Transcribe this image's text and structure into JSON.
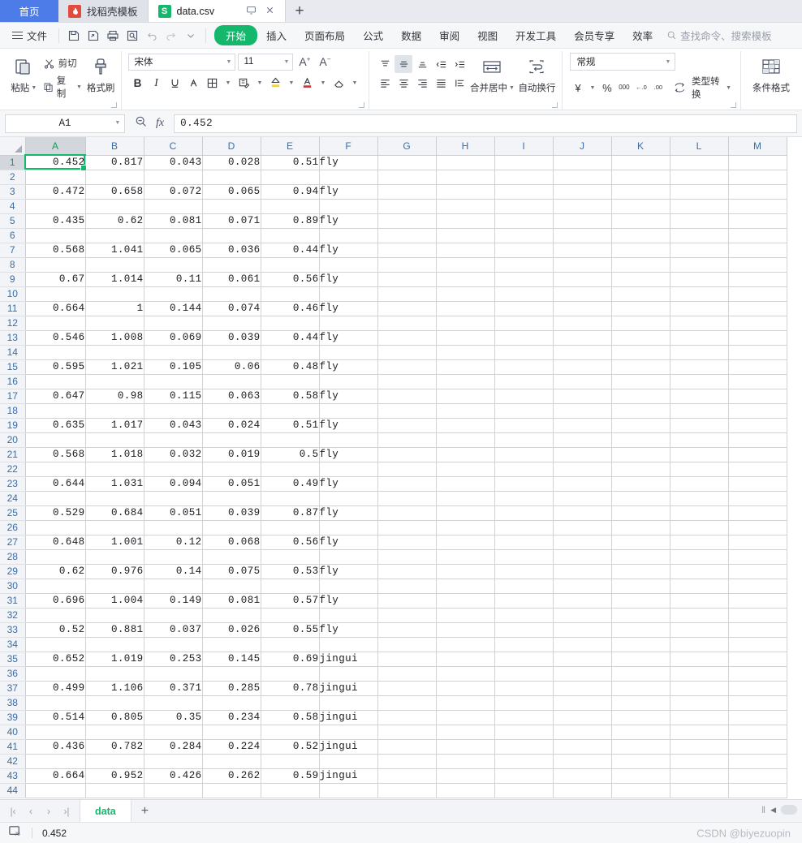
{
  "window": {
    "tabs": [
      {
        "label": "首页",
        "icon": "home-tab",
        "active": false,
        "kind": "home"
      },
      {
        "label": "找稻壳模板",
        "icon": "docer-icon",
        "active": false,
        "kind": "docer"
      },
      {
        "label": "data.csv",
        "icon": "sheet-icon",
        "active": true,
        "kind": "sheet"
      }
    ],
    "tab_actions": {
      "restore": "monitor-icon",
      "close": "close-icon"
    },
    "new_tab_label": "+"
  },
  "menubar": {
    "file_label": "文件",
    "quick_access": [
      "save-icon",
      "save-as-icon",
      "print-icon",
      "print-preview-icon",
      "undo-icon",
      "redo-icon",
      "customize-caret-icon"
    ],
    "start_tab": "开始",
    "items": [
      "插入",
      "页面布局",
      "公式",
      "数据",
      "审阅",
      "视图",
      "开发工具",
      "会员专享",
      "效率"
    ],
    "search_placeholder": "查找命令、搜索模板"
  },
  "ribbon": {
    "clipboard": {
      "paste": "粘贴",
      "cut": "剪切",
      "copy": "复制",
      "format_painter": "格式刷"
    },
    "font": {
      "name": "宋体",
      "size": "11",
      "grow": "A+",
      "shrink": "A-",
      "bold": "B",
      "italic": "I",
      "underline": "U",
      "strikethrough": "A",
      "borders": "borders-icon",
      "more_format": "more-format-icon",
      "fill_color": "fill-color-icon",
      "font_color": "font-color-icon",
      "clear_format": "clear-format-icon"
    },
    "alignment": {
      "merge_center": "合并居中",
      "wrap_text": "自动换行"
    },
    "number": {
      "format": "常规",
      "currency": "¥",
      "percent": "%",
      "comma": "000",
      "increase_decimal": "←.0",
      "decrease_decimal": ".00",
      "type_convert": "类型转换"
    },
    "styles": {
      "conditional_format": "条件格式"
    }
  },
  "formula_bar": {
    "name_box": "A1",
    "zoom_icon": "zoom-out-icon",
    "fx_icon": "fx",
    "formula_value": "0.452"
  },
  "grid": {
    "columns": [
      "A",
      "B",
      "C",
      "D",
      "E",
      "F",
      "G",
      "H",
      "I",
      "J",
      "K",
      "L",
      "M"
    ],
    "selected_column": "A",
    "selected_row": 1,
    "selected_cell": "A1",
    "row_count": 44,
    "rows": [
      {
        "n": 1,
        "cells": [
          "0.452",
          "0.817",
          "0.043",
          "0.028",
          "0.51",
          "fly"
        ]
      },
      {
        "n": 2,
        "cells": [
          "",
          "",
          "",
          "",
          "",
          ""
        ]
      },
      {
        "n": 3,
        "cells": [
          "0.472",
          "0.658",
          "0.072",
          "0.065",
          "0.94",
          "fly"
        ]
      },
      {
        "n": 4,
        "cells": [
          "",
          "",
          "",
          "",
          "",
          ""
        ]
      },
      {
        "n": 5,
        "cells": [
          "0.435",
          "0.62",
          "0.081",
          "0.071",
          "0.89",
          "fly"
        ]
      },
      {
        "n": 6,
        "cells": [
          "",
          "",
          "",
          "",
          "",
          ""
        ]
      },
      {
        "n": 7,
        "cells": [
          "0.568",
          "1.041",
          "0.065",
          "0.036",
          "0.44",
          "fly"
        ]
      },
      {
        "n": 8,
        "cells": [
          "",
          "",
          "",
          "",
          "",
          ""
        ]
      },
      {
        "n": 9,
        "cells": [
          "0.67",
          "1.014",
          "0.11",
          "0.061",
          "0.56",
          "fly"
        ]
      },
      {
        "n": 10,
        "cells": [
          "",
          "",
          "",
          "",
          "",
          ""
        ]
      },
      {
        "n": 11,
        "cells": [
          "0.664",
          "1",
          "0.144",
          "0.074",
          "0.46",
          "fly"
        ]
      },
      {
        "n": 12,
        "cells": [
          "",
          "",
          "",
          "",
          "",
          ""
        ]
      },
      {
        "n": 13,
        "cells": [
          "0.546",
          "1.008",
          "0.069",
          "0.039",
          "0.44",
          "fly"
        ]
      },
      {
        "n": 14,
        "cells": [
          "",
          "",
          "",
          "",
          "",
          ""
        ]
      },
      {
        "n": 15,
        "cells": [
          "0.595",
          "1.021",
          "0.105",
          "0.06",
          "0.48",
          "fly"
        ]
      },
      {
        "n": 16,
        "cells": [
          "",
          "",
          "",
          "",
          "",
          ""
        ]
      },
      {
        "n": 17,
        "cells": [
          "0.647",
          "0.98",
          "0.115",
          "0.063",
          "0.58",
          "fly"
        ]
      },
      {
        "n": 18,
        "cells": [
          "",
          "",
          "",
          "",
          "",
          ""
        ]
      },
      {
        "n": 19,
        "cells": [
          "0.635",
          "1.017",
          "0.043",
          "0.024",
          "0.51",
          "fly"
        ]
      },
      {
        "n": 20,
        "cells": [
          "",
          "",
          "",
          "",
          "",
          ""
        ]
      },
      {
        "n": 21,
        "cells": [
          "0.568",
          "1.018",
          "0.032",
          "0.019",
          "0.5",
          "fly"
        ]
      },
      {
        "n": 22,
        "cells": [
          "",
          "",
          "",
          "",
          "",
          ""
        ]
      },
      {
        "n": 23,
        "cells": [
          "0.644",
          "1.031",
          "0.094",
          "0.051",
          "0.49",
          "fly"
        ]
      },
      {
        "n": 24,
        "cells": [
          "",
          "",
          "",
          "",
          "",
          ""
        ]
      },
      {
        "n": 25,
        "cells": [
          "0.529",
          "0.684",
          "0.051",
          "0.039",
          "0.87",
          "fly"
        ]
      },
      {
        "n": 26,
        "cells": [
          "",
          "",
          "",
          "",
          "",
          ""
        ]
      },
      {
        "n": 27,
        "cells": [
          "0.648",
          "1.001",
          "0.12",
          "0.068",
          "0.56",
          "fly"
        ]
      },
      {
        "n": 28,
        "cells": [
          "",
          "",
          "",
          "",
          "",
          ""
        ]
      },
      {
        "n": 29,
        "cells": [
          "0.62",
          "0.976",
          "0.14",
          "0.075",
          "0.53",
          "fly"
        ]
      },
      {
        "n": 30,
        "cells": [
          "",
          "",
          "",
          "",
          "",
          ""
        ]
      },
      {
        "n": 31,
        "cells": [
          "0.696",
          "1.004",
          "0.149",
          "0.081",
          "0.57",
          "fly"
        ]
      },
      {
        "n": 32,
        "cells": [
          "",
          "",
          "",
          "",
          "",
          ""
        ]
      },
      {
        "n": 33,
        "cells": [
          "0.52",
          "0.881",
          "0.037",
          "0.026",
          "0.55",
          "fly"
        ]
      },
      {
        "n": 34,
        "cells": [
          "",
          "",
          "",
          "",
          "",
          ""
        ]
      },
      {
        "n": 35,
        "cells": [
          "0.652",
          "1.019",
          "0.253",
          "0.145",
          "0.69",
          "jingui"
        ]
      },
      {
        "n": 36,
        "cells": [
          "",
          "",
          "",
          "",
          "",
          ""
        ]
      },
      {
        "n": 37,
        "cells": [
          "0.499",
          "1.106",
          "0.371",
          "0.285",
          "0.78",
          "jingui"
        ]
      },
      {
        "n": 38,
        "cells": [
          "",
          "",
          "",
          "",
          "",
          ""
        ]
      },
      {
        "n": 39,
        "cells": [
          "0.514",
          "0.805",
          "0.35",
          "0.234",
          "0.58",
          "jingui"
        ]
      },
      {
        "n": 40,
        "cells": [
          "",
          "",
          "",
          "",
          "",
          ""
        ]
      },
      {
        "n": 41,
        "cells": [
          "0.436",
          "0.782",
          "0.284",
          "0.224",
          "0.52",
          "jingui"
        ]
      },
      {
        "n": 42,
        "cells": [
          "",
          "",
          "",
          "",
          "",
          ""
        ]
      },
      {
        "n": 43,
        "cells": [
          "0.664",
          "0.952",
          "0.426",
          "0.262",
          "0.59",
          "jingui"
        ]
      },
      {
        "n": 44,
        "cells": [
          "",
          "",
          "",
          "",
          "",
          ""
        ]
      }
    ]
  },
  "sheetbar": {
    "nav": [
      "first-sheet-icon",
      "prev-sheet-icon",
      "next-sheet-icon",
      "last-sheet-icon"
    ],
    "sheets": [
      {
        "name": "data",
        "active": true
      }
    ],
    "add_sheet": "+"
  },
  "statusbar": {
    "macro_icon": "js-macro-icon",
    "value": "0.452",
    "watermark": "CSDN @biyezuopin"
  },
  "colors": {
    "accent_green": "#15b76d",
    "tab_home_blue": "#4d7ce8",
    "header_blue": "#3a6ea5",
    "docer_red": "#e24a3b"
  }
}
